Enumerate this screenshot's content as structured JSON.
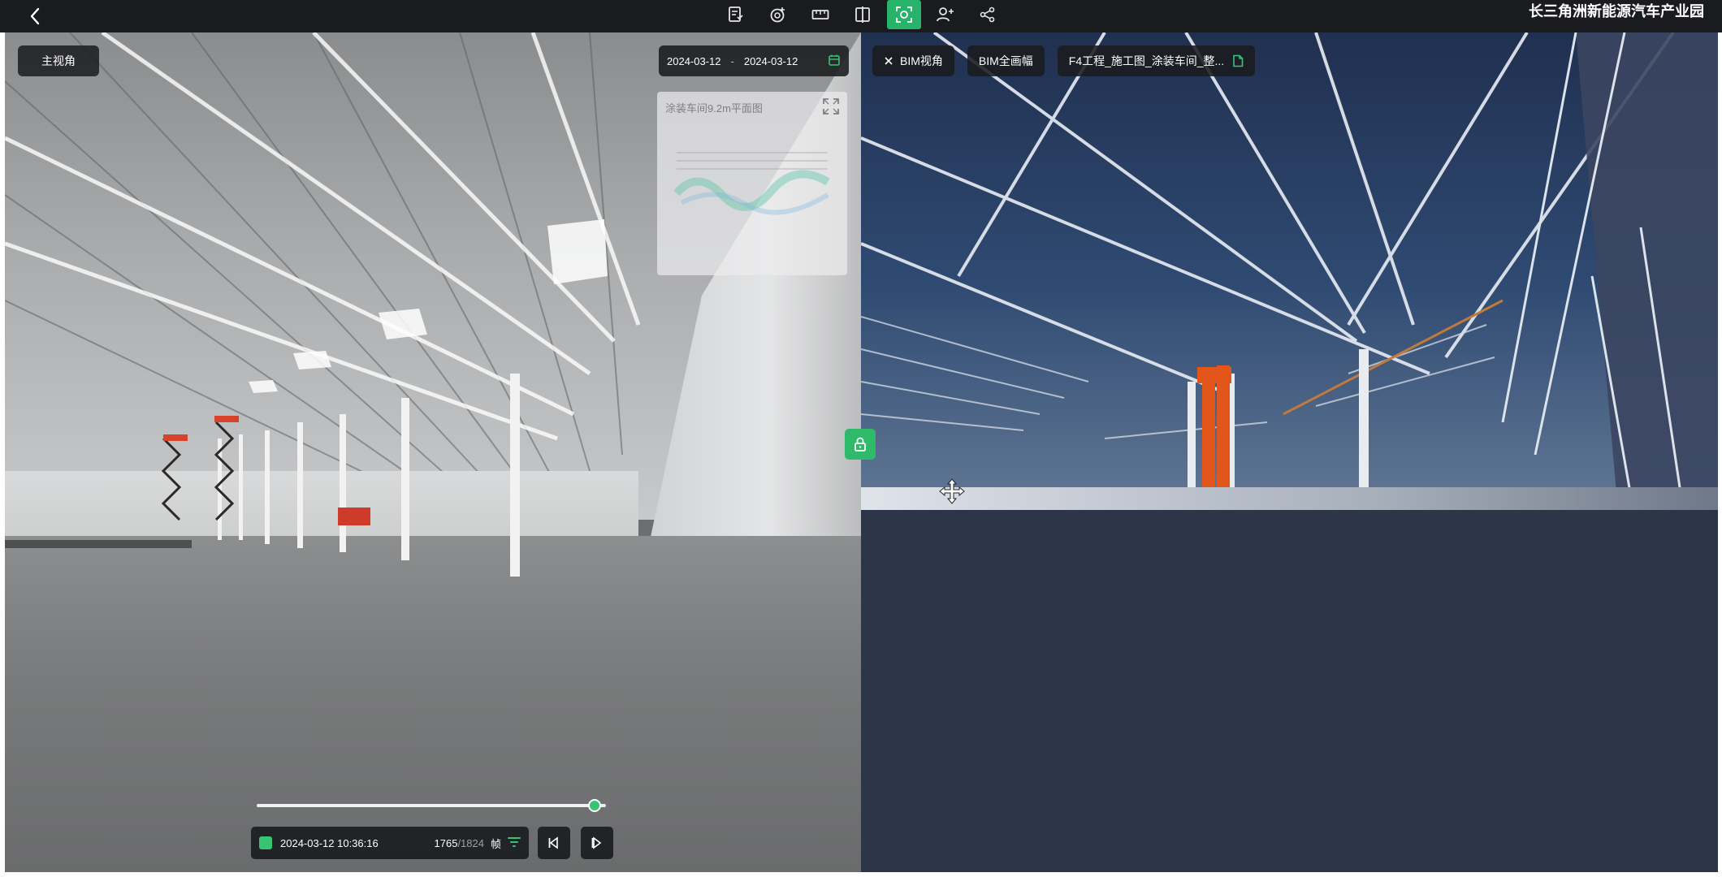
{
  "topbar": {
    "back_icon": "chevron-left-icon",
    "tools": [
      {
        "name": "report-icon",
        "active": false
      },
      {
        "name": "target-add-icon",
        "active": false
      },
      {
        "name": "ruler-icon",
        "active": false
      },
      {
        "name": "split-compare-icon",
        "active": false
      },
      {
        "name": "scan-view-icon",
        "active": true
      },
      {
        "name": "user-add-icon",
        "active": false
      },
      {
        "name": "share-icon",
        "active": false
      }
    ],
    "project_title": "长三角洲新能源汽车产业园"
  },
  "left_view": {
    "main_view_label": "主视角",
    "date_start": "2024-03-12",
    "date_separator": "-",
    "date_end": "2024-03-12",
    "minimap_title": "涂装车间9.2m平面图",
    "timeline": {
      "progress": 0.968,
      "timestamp": "2024-03-12 10:36:16",
      "frame_current": "1765",
      "frame_total": "/1824",
      "frame_unit": "帧"
    }
  },
  "right_view": {
    "bim_view_label": "BIM视角",
    "bim_full_label": "BIM全画幅",
    "model_file_label": "F4工程_施工图_涂装车间_整..."
  },
  "colors": {
    "accent_green": "#27b36a",
    "bar_dark": "#1a1b1e",
    "bim_floor": "#2d3549",
    "column_orange": "#e2561c"
  }
}
